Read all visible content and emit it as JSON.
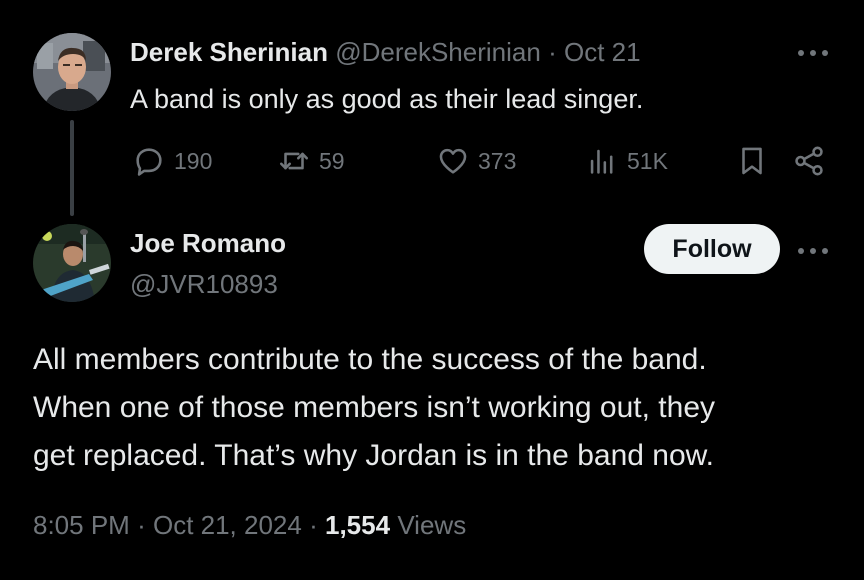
{
  "parent_tweet": {
    "author_name": "Derek Sherinian",
    "handle": "@DerekSherinian",
    "separator": "·",
    "date": "Oct 21",
    "text": "A band is only as good as their lead singer.",
    "stats": {
      "replies": "190",
      "retweets": "59",
      "likes": "373",
      "views": "51K"
    },
    "icons": [
      "avatar",
      "more-icon",
      "reply-icon",
      "retweet-icon",
      "like-icon",
      "views-icon",
      "bookmark-icon",
      "share-icon"
    ]
  },
  "reply_tweet": {
    "author_name": "Joe Romano",
    "handle": "@JVR10893",
    "follow_label": "Follow",
    "body_lines": [
      "All members contribute to the success of the band.",
      "When one of those members isn’t working out, they",
      "get replaced. That’s why Jordan is in the band now."
    ],
    "meta": {
      "time": "8:05 PM",
      "separator": "·",
      "date": "Oct 21, 2024",
      "views_count": "1,554",
      "views_label": "Views"
    }
  },
  "colors": {
    "background": "#000000",
    "text_primary": "#e7e9ea",
    "text_muted": "#71767b",
    "follow_bg": "#eff3f4",
    "follow_text": "#0f1419",
    "thread_line": "#3a3f44"
  }
}
